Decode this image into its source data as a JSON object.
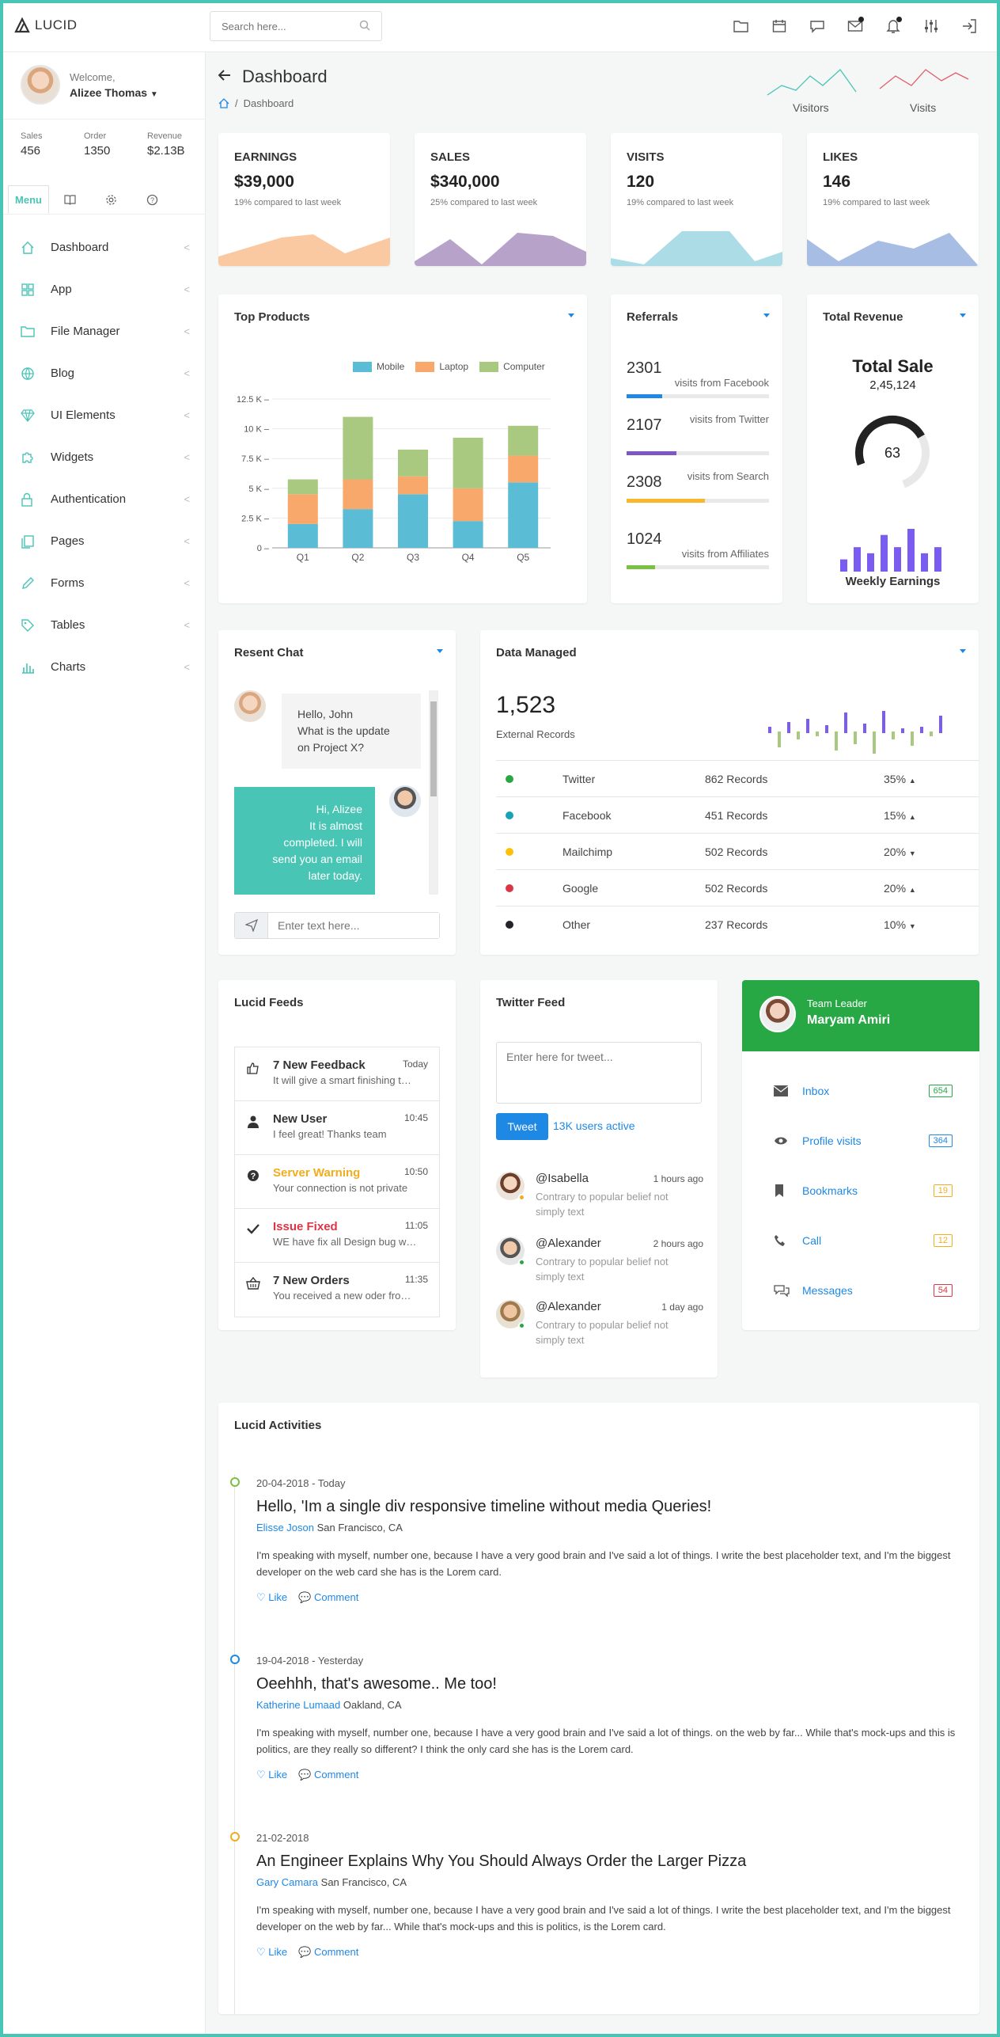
{
  "brand": {
    "name": "LUCID"
  },
  "search": {
    "placeholder": "Search here..."
  },
  "user": {
    "welcome": "Welcome,",
    "name": "Alizee Thomas"
  },
  "stats": [
    {
      "label": "Sales",
      "value": "456"
    },
    {
      "label": "Order",
      "value": "1350"
    },
    {
      "label": "Revenue",
      "value": "$2.13B"
    }
  ],
  "sidebar_tabs": {
    "menu": "Menu"
  },
  "menu": [
    "Dashboard",
    "App",
    "File Manager",
    "Blog",
    "UI Elements",
    "Widgets",
    "Authentication",
    "Pages",
    "Forms",
    "Tables",
    "Charts"
  ],
  "page": {
    "title": "Dashboard",
    "breadcrumb": "Dashboard"
  },
  "sparks": {
    "visitors": "Visitors",
    "visits": "Visits"
  },
  "kpis": [
    {
      "label": "EARNINGS",
      "value": "$39,000",
      "sub": "19% compared to last week",
      "color": "#fbc9a1"
    },
    {
      "label": "SALES",
      "value": "$340,000",
      "sub": "25% compared to last week",
      "color": "#b7a3c9"
    },
    {
      "label": "VISITS",
      "value": "120",
      "sub": "19% compared to last week",
      "color": "#acdde6"
    },
    {
      "label": "LIKES",
      "value": "146",
      "sub": "19% compared to last week",
      "color": "#a7bde3"
    }
  ],
  "top_products": {
    "title": "Top Products"
  },
  "chart_data": {
    "type": "bar",
    "stacked": true,
    "categories": [
      "Q1",
      "Q2",
      "Q3",
      "Q4",
      "Q5"
    ],
    "series": [
      {
        "name": "Mobile",
        "color": "#5bbcd6",
        "values": [
          4000,
          6500,
          9000,
          4500,
          11000
        ]
      },
      {
        "name": "Laptop",
        "color": "#f9a86b",
        "values": [
          5000,
          5000,
          3000,
          5500,
          4500
        ]
      },
      {
        "name": "Computer",
        "color": "#a8c97f",
        "values": [
          2500,
          10500,
          4500,
          8500,
          5000
        ]
      }
    ],
    "yticks": [
      "0",
      "2.5 K",
      "5 K",
      "7.5 K",
      "10 K",
      "12.5 K"
    ],
    "ylim": [
      0,
      25000
    ],
    "ylabel_scale": 0.5,
    "grid": true,
    "legend": "top-right"
  },
  "referrals": {
    "title": "Referrals",
    "items": [
      {
        "value": "2301",
        "label": "visits from Facebook",
        "pct": 0.25,
        "color": "#1e88e5"
      },
      {
        "value": "2107",
        "label": "visits from Twitter",
        "pct": 0.35,
        "color": "#7e57c2"
      },
      {
        "value": "2308",
        "label": "visits from Search",
        "pct": 0.55,
        "color": "#fbb72c"
      },
      {
        "value": "1024",
        "label": "visits from Affiliates",
        "pct": 0.2,
        "color": "#79c143"
      }
    ]
  },
  "revenue": {
    "title": "Total Revenue",
    "heading": "Total Sale",
    "amount": "2,45,124",
    "gauge": "63",
    "gauge_pct": 0.63,
    "footer": "Weekly Earnings",
    "bars": [
      2,
      4,
      3,
      6,
      4,
      7,
      3,
      4
    ]
  },
  "chat": {
    "title": "Resent Chat",
    "msg1": [
      "Hello, John",
      "What is the update",
      "on Project X?"
    ],
    "msg2": [
      "Hi, Alizee",
      "It is almost",
      "completed. I will",
      "send you an email",
      "later today."
    ],
    "placeholder": "Enter text here..."
  },
  "data_managed": {
    "title": "Data Managed",
    "total": "1,523",
    "subtitle": "External Records",
    "rows": [
      {
        "name": "Twitter",
        "records": "862 Records",
        "pct": "35%",
        "trend": "up",
        "color": "#28a745"
      },
      {
        "name": "Facebook",
        "records": "451 Records",
        "pct": "15%",
        "trend": "up",
        "color": "#17a2b8"
      },
      {
        "name": "Mailchimp",
        "records": "502 Records",
        "pct": "20%",
        "trend": "down",
        "color": "#ffc107"
      },
      {
        "name": "Google",
        "records": "502 Records",
        "pct": "20%",
        "trend": "up",
        "color": "#dc3545"
      },
      {
        "name": "Other",
        "records": "237 Records",
        "pct": "10%",
        "trend": "down",
        "color": "#212529"
      }
    ]
  },
  "feeds": {
    "title": "Lucid Feeds",
    "items": [
      {
        "title": "7 New Feedback",
        "desc": "It will give a smart finishing to your site",
        "time": "Today",
        "color": "#333",
        "icon": "thumbs-up-icon"
      },
      {
        "title": "New User",
        "desc": "I feel great! Thanks team",
        "time": "10:45",
        "color": "#333",
        "icon": "user-icon"
      },
      {
        "title": "Server Warning",
        "desc": "Your connection is not private",
        "time": "10:50",
        "color": "#f0ad1f",
        "icon": "question-icon"
      },
      {
        "title": "Issue Fixed",
        "desc": "WE have fix all Design bug with Responsive",
        "time": "11:05",
        "color": "#dc3545",
        "icon": "check-icon"
      },
      {
        "title": "7 New Orders",
        "desc": "You received a new oder from Tina.",
        "time": "11:35",
        "color": "#333",
        "icon": "basket-icon"
      }
    ]
  },
  "twitter": {
    "title": "Twitter Feed",
    "placeholder": "Enter here for tweet...",
    "button": "Tweet",
    "active": "13K users active",
    "tweets": [
      {
        "user": "@Isabella",
        "time": "1 hours ago",
        "text": "Contrary to popular belief not simply text",
        "status": "#f0ad1f"
      },
      {
        "user": "@Alexander",
        "time": "2 hours ago",
        "text": "Contrary to popular belief not simply text",
        "status": "#28a745"
      },
      {
        "user": "@Alexander",
        "time": "1 day ago",
        "text": "Contrary to popular belief not simply text",
        "status": "#28a745"
      }
    ]
  },
  "team": {
    "role": "Team Leader",
    "name": "Maryam Amiri",
    "items": [
      {
        "label": "Inbox",
        "badge": "654",
        "color": "#28a745",
        "icon": "envelope-icon"
      },
      {
        "label": "Profile visits",
        "badge": "364",
        "color": "#1e88e5",
        "icon": "eye-icon"
      },
      {
        "label": "Bookmarks",
        "badge": "19",
        "color": "#f0ad1f",
        "icon": "bookmark-icon"
      },
      {
        "label": "Call",
        "badge": "12",
        "color": "#f0ad1f",
        "icon": "phone-icon"
      },
      {
        "label": "Messages",
        "badge": "54",
        "color": "#dc3545",
        "icon": "comments-icon"
      }
    ]
  },
  "activities": {
    "title": "Lucid Activities",
    "like": "Like",
    "comment": "Comment",
    "items": [
      {
        "date": "20-04-2018 - Today",
        "title": "Hello, 'Im a single div responsive timeline without media Queries!",
        "author": "Elisse Joson",
        "location": "San Francisco, CA",
        "body": "I'm speaking with myself, number one, because I have a very good brain and I've said a lot of things. I write the best placeholder text, and I'm the biggest developer on the web card she has is the Lorem card.",
        "color": "#79c143"
      },
      {
        "date": "19-04-2018 - Yesterday",
        "title": "Oeehhh, that's awesome.. Me too!",
        "author": "Katherine Lumaad",
        "location": "Oakland, CA",
        "body": "I'm speaking with myself, number one, because I have a very good brain and I've said a lot of things. on the web by far... While that's mock-ups and this is politics, are they really so different? I think the only card she has is the Lorem card.",
        "color": "#1e88e5"
      },
      {
        "date": "21-02-2018",
        "title": "An Engineer Explains Why You Should Always Order the Larger Pizza",
        "author": "Gary Camara",
        "location": "San Francisco, CA",
        "body": "I'm speaking with myself, number one, because I have a very good brain and I've said a lot of things. I write the best placeholder text, and I'm the biggest developer on the web by far... While that's mock-ups and this is politics, is the Lorem card.",
        "color": "#f0ad1f"
      }
    ]
  }
}
